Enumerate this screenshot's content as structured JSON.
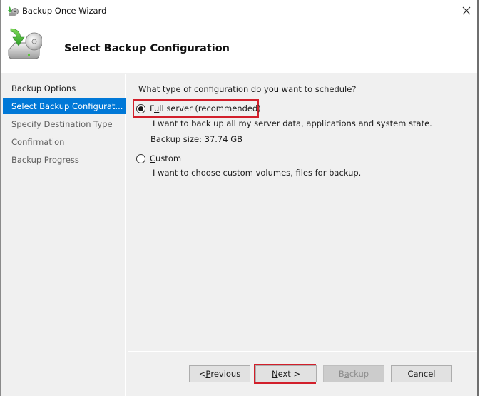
{
  "window": {
    "title": "Backup Once Wizard",
    "icons": {
      "app": "backup-disk-icon",
      "close": "close-icon"
    }
  },
  "header": {
    "title": "Select Backup Configuration",
    "icon": "backup-disk-arrow-icon"
  },
  "nav": {
    "items": [
      {
        "label": "Backup Options",
        "state": "visited"
      },
      {
        "label": "Select Backup Configurat...",
        "state": "selected"
      },
      {
        "label": "Specify Destination Type",
        "state": "pending"
      },
      {
        "label": "Confirmation",
        "state": "pending"
      },
      {
        "label": "Backup Progress",
        "state": "pending"
      }
    ]
  },
  "content": {
    "question": "What type of configuration do you want to schedule?",
    "options": [
      {
        "label_pre": "F",
        "label_key": "u",
        "label_post": "ll server (recommended)",
        "checked": true,
        "description": "I want to back up all my server data, applications and system state.",
        "detail": "Backup size: 37.74 GB"
      },
      {
        "label_pre": "",
        "label_key": "C",
        "label_post": "ustom",
        "checked": false,
        "description": "I want to choose custom volumes, files for backup."
      }
    ]
  },
  "buttons": {
    "previous": {
      "pre": "< ",
      "key": "P",
      "post": "revious",
      "enabled": true
    },
    "next": {
      "pre": "",
      "key": "N",
      "post": "ext >",
      "enabled": true
    },
    "backup": {
      "pre": "B",
      "key": "a",
      "post": "ckup",
      "enabled": false
    },
    "cancel": {
      "label": "Cancel",
      "enabled": true
    }
  },
  "annotations": {
    "highlight_color": "#d21f2b",
    "highlighted": [
      "full-server-option",
      "next-button"
    ]
  },
  "colors": {
    "selection": "#0078d7",
    "window_bg": "#f0f0f0"
  }
}
